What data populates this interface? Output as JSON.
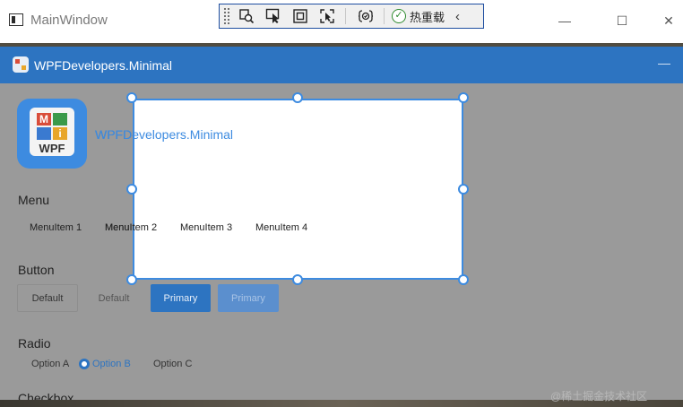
{
  "window": {
    "title": "MainWindow",
    "controls": {
      "minimize": "—",
      "maximize": "☐",
      "close": "✕"
    }
  },
  "debug_toolbar": {
    "tools": [
      "select-element",
      "inspect-pointer",
      "display-layout-adorners",
      "track-focused-element",
      "binding-failures"
    ],
    "hot_reload_label": "热重载",
    "collapse_glyph": "‹"
  },
  "app": {
    "header_title": "WPFDevelopers.Minimal",
    "header_min": "—",
    "title": "WPFDevelopers.Minimal",
    "logo": {
      "letters": [
        "M",
        "i"
      ],
      "text": "WPF",
      "tile_colors": [
        "#d94d3a",
        "#3a9a4a",
        "#3a7ad0",
        "#e8a62a"
      ]
    },
    "accent_color": "#2d74c1"
  },
  "sections": {
    "menu": {
      "label": "Menu",
      "items": [
        "MenuItem 1",
        "MenuItem 2",
        "MenuItem 3",
        "MenuItem 4"
      ]
    },
    "button": {
      "label": "Button",
      "buttons": [
        {
          "label": "Default",
          "style": "default",
          "enabled": true
        },
        {
          "label": "Default",
          "style": "default",
          "enabled": false
        },
        {
          "label": "Primary",
          "style": "primary",
          "enabled": true
        },
        {
          "label": "Primary",
          "style": "primary",
          "enabled": false
        }
      ]
    },
    "radio": {
      "label": "Radio",
      "options": [
        "Option A",
        "Option B",
        "Option C"
      ],
      "selected": "Option B"
    },
    "next_label": "Checkbox"
  },
  "watermark": "@稀土掘金技术社区"
}
